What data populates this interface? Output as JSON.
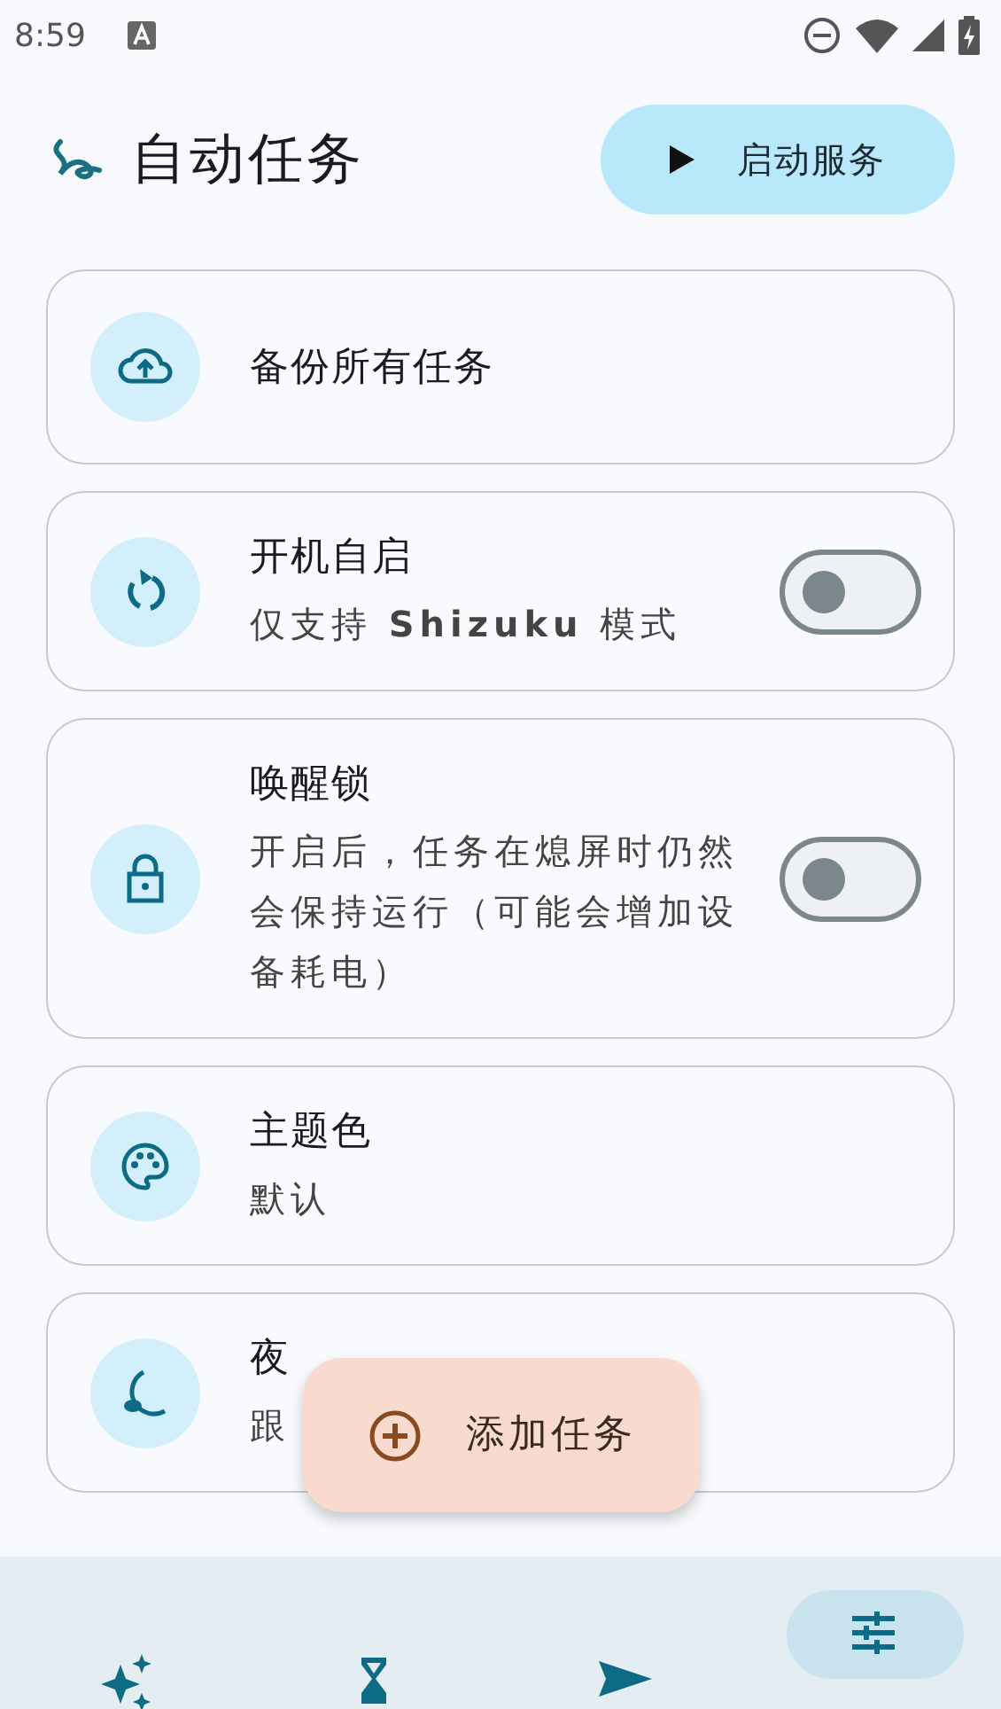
{
  "status_bar": {
    "time": "8:59"
  },
  "header": {
    "title": "自动任务",
    "start_button": "启动服务"
  },
  "settings": [
    {
      "title": "备份所有任务"
    },
    {
      "title": "开机自启",
      "subtitle": "仅支持 **Shizuku** 模式",
      "on": false
    },
    {
      "title": "唤醒锁",
      "subtitle": "开启后，任务在熄屏时仍然会保持运行（可能会增加设备耗电）",
      "on": false
    },
    {
      "title": "主题色",
      "subtitle": "默认"
    },
    {
      "title": "夜",
      "subtitle": "跟"
    }
  ],
  "fab": {
    "label": "添加任务"
  },
  "bottom_nav": [
    {
      "selected": false
    },
    {
      "selected": false
    },
    {
      "selected": false
    },
    {
      "selected": true
    }
  ]
}
